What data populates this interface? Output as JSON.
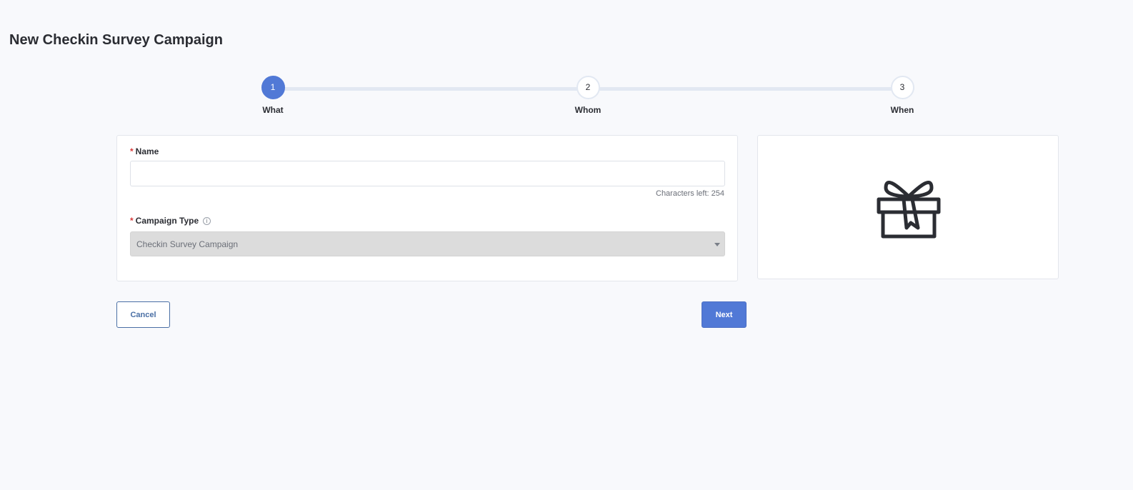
{
  "page": {
    "title": "New Checkin Survey Campaign"
  },
  "stepper": {
    "steps": [
      {
        "number": "1",
        "label": "What",
        "active": true
      },
      {
        "number": "2",
        "label": "Whom",
        "active": false
      },
      {
        "number": "3",
        "label": "When",
        "active": false
      }
    ]
  },
  "form": {
    "required_marker": "*",
    "name": {
      "label": "Name",
      "value": "",
      "placeholder": "",
      "characters_left": "Characters left: 254"
    },
    "campaign_type": {
      "label": "Campaign Type",
      "info_icon": "info-icon",
      "selected": "Checkin Survey Campaign"
    }
  },
  "preview": {
    "icon": "gift-icon"
  },
  "actions": {
    "cancel_label": "Cancel",
    "next_label": "Next"
  },
  "colors": {
    "accent": "#5179d6",
    "required": "#d83a3a",
    "background": "#f8f9fc"
  }
}
